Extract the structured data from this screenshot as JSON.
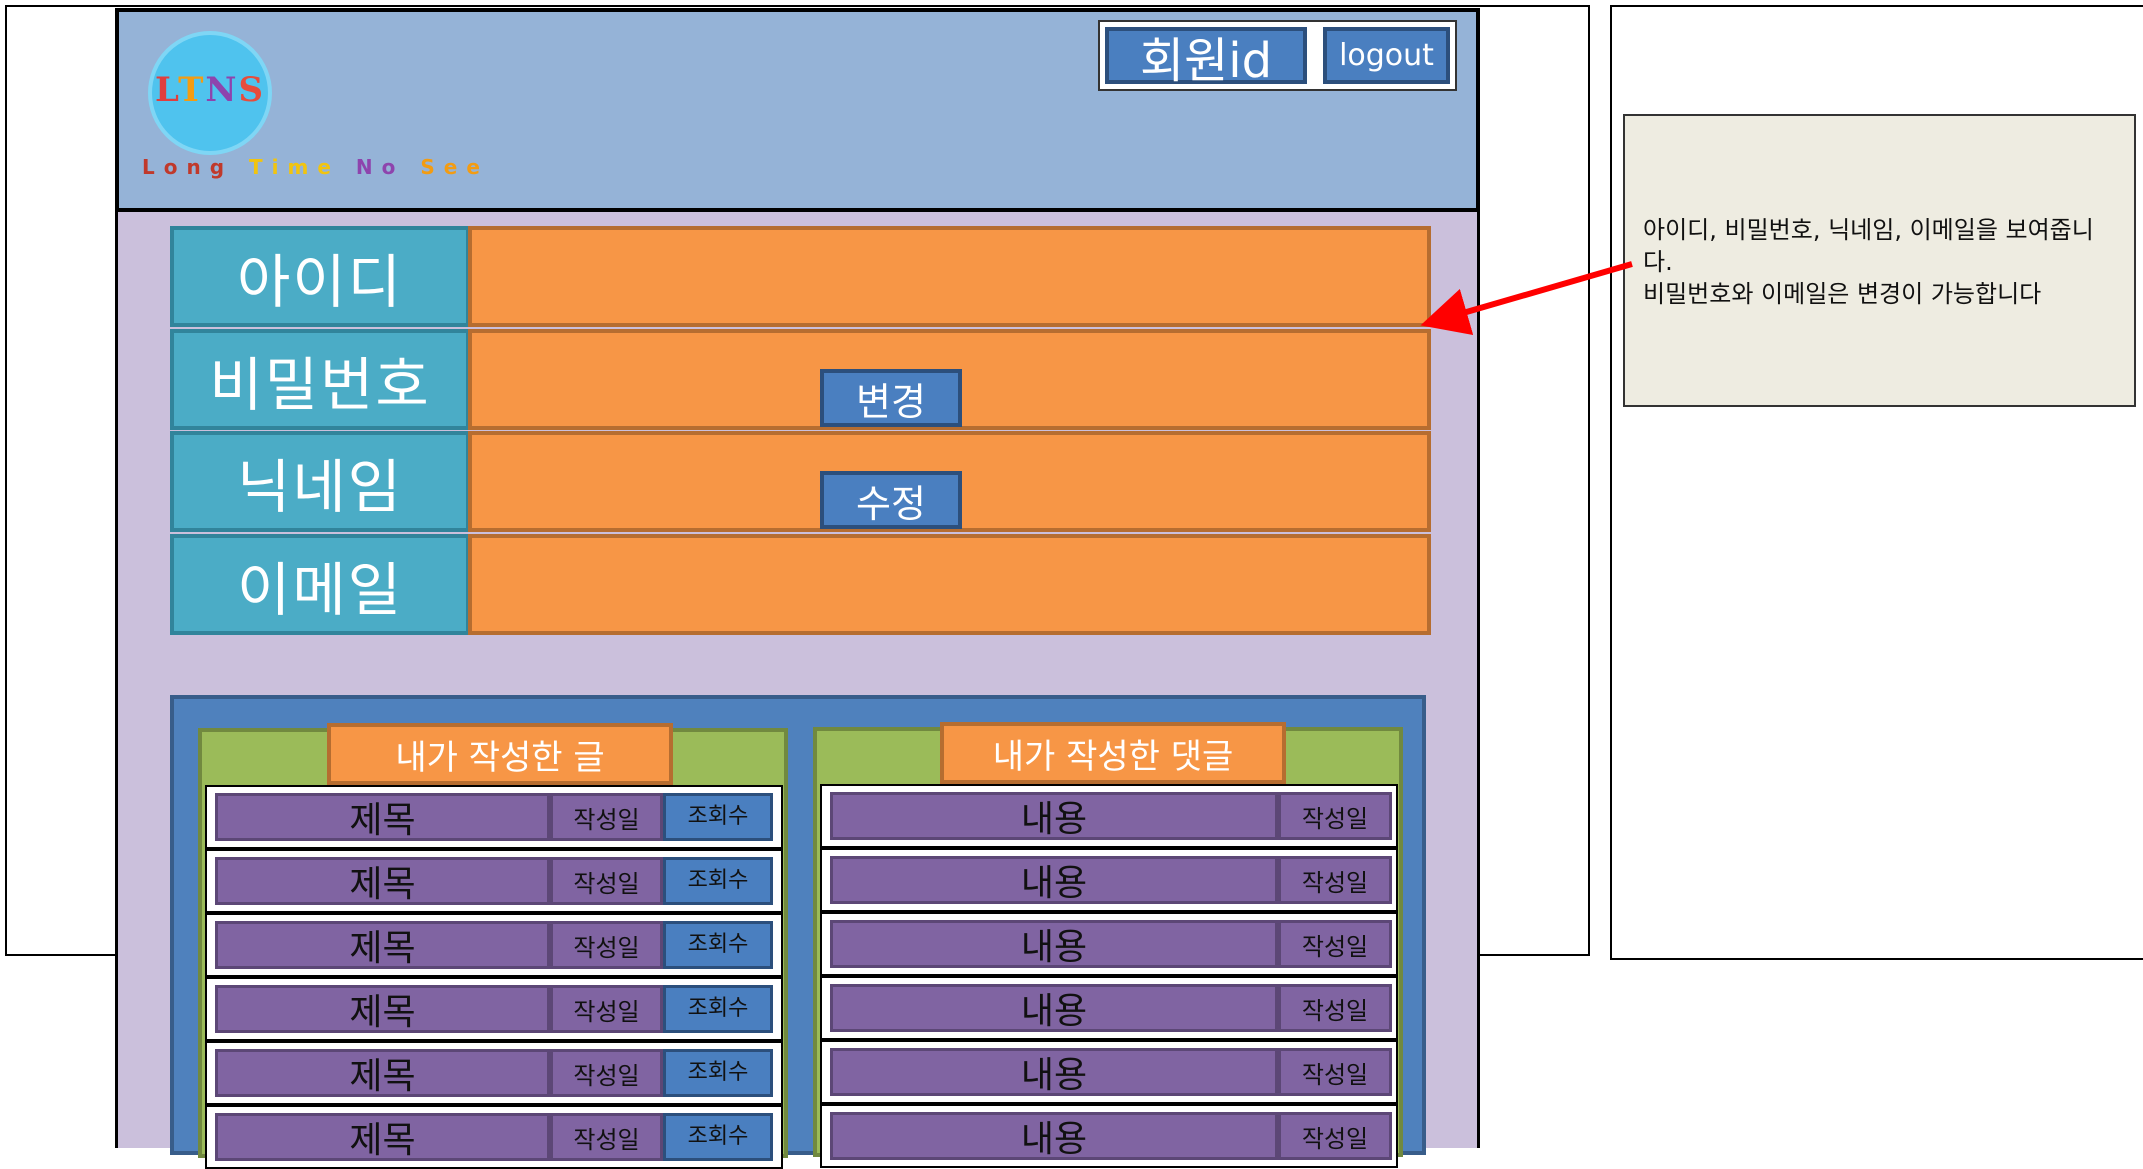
{
  "header": {
    "logo_text": "LTNS",
    "tagline": [
      "Long",
      "Time",
      "No",
      "See"
    ],
    "member_id": "회원id",
    "logout": "logout"
  },
  "profile": {
    "rows": [
      {
        "label": "아이디",
        "button": ""
      },
      {
        "label": "비밀번호",
        "button": "변경"
      },
      {
        "label": "닉네임",
        "button": "수정"
      },
      {
        "label": "이메일",
        "button": ""
      }
    ]
  },
  "posts": {
    "tab": "내가 작성한 글",
    "rows": [
      {
        "title": "제목",
        "date": "작성일",
        "views": "조회수"
      },
      {
        "title": "제목",
        "date": "작성일",
        "views": "조회수"
      },
      {
        "title": "제목",
        "date": "작성일",
        "views": "조회수"
      },
      {
        "title": "제목",
        "date": "작성일",
        "views": "조회수"
      },
      {
        "title": "제목",
        "date": "작성일",
        "views": "조회수"
      },
      {
        "title": "제목",
        "date": "작성일",
        "views": "조회수"
      }
    ]
  },
  "comments": {
    "tab": "내가 작성한 댓글",
    "rows": [
      {
        "content": "내용",
        "date": "작성일"
      },
      {
        "content": "내용",
        "date": "작성일"
      },
      {
        "content": "내용",
        "date": "작성일"
      },
      {
        "content": "내용",
        "date": "작성일"
      },
      {
        "content": "내용",
        "date": "작성일"
      },
      {
        "content": "내용",
        "date": "작성일"
      }
    ]
  },
  "annotation": {
    "line1": "아이디, 비밀번호, 닉네임, 이메일을 보여줍니다.",
    "line2": "비밀번호와 이메일은 변경이 가능합니다"
  },
  "colors": {
    "header_bg": "#95b3d7",
    "page_bg": "#cbc0dc",
    "label_bg": "#4bacc6",
    "value_bg": "#f79646",
    "button_bg": "#4a7fc0",
    "panel_bg": "#4f81bd",
    "column_bg": "#9bbb59",
    "row_cell_bg": "#8064a2",
    "arrow": "#ff0000"
  }
}
